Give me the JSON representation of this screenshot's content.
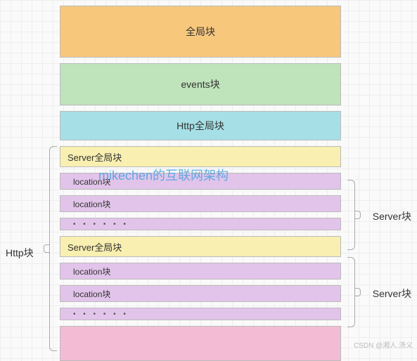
{
  "global_block": "全局块",
  "events_block": "events块",
  "http_global": "Http全局块",
  "server_global": "Server全局块",
  "location_block": "location块",
  "dots": "• • • • • •",
  "brace_http": "Http块",
  "brace_server": "Server块",
  "watermark": "mikechen的互联网架构",
  "credit": "CSDN @湘人.汤义"
}
